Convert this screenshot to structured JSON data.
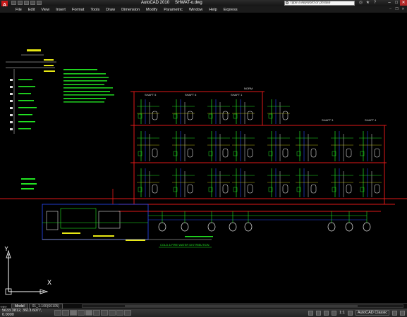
{
  "window": {
    "app_title": "AutoCAD 2010",
    "file_name": "SHWAT-o.dwg",
    "logo": "A",
    "search_placeholder": "Type a keyword or phrase"
  },
  "menu": [
    "File",
    "Edit",
    "View",
    "Insert",
    "Format",
    "Tools",
    "Draw",
    "Dimension",
    "Modify",
    "Parametric",
    "Window",
    "Help",
    "Express"
  ],
  "drawing": {
    "heading": "COLD & FIRE WATER DISTRIBUTION",
    "labels": {
      "shaft_5": "SHAFT 5",
      "shaft_6": "SHAFT 6",
      "shaft_1": "SHAFT 1",
      "shaft_3": "SHAFT 3",
      "shaft_4": "SHAFT 4",
      "nordm": "NORM"
    }
  },
  "ucs": {
    "x": "X",
    "y": "Y"
  },
  "tabs": {
    "model": "Model",
    "layout": "01_1-100(60105)"
  },
  "status": {
    "coordinates": "5633.3812, 3613.6077, 0.0000",
    "scale": "1:1",
    "workspace": "AutoCAD Classic"
  },
  "colors": {
    "background": "#000000",
    "pipe_red": "#e01818",
    "pipe_green": "#22e422",
    "text_yellow": "#e8e814",
    "line_white": "#dddddd",
    "line_blue": "#2a4cff"
  }
}
